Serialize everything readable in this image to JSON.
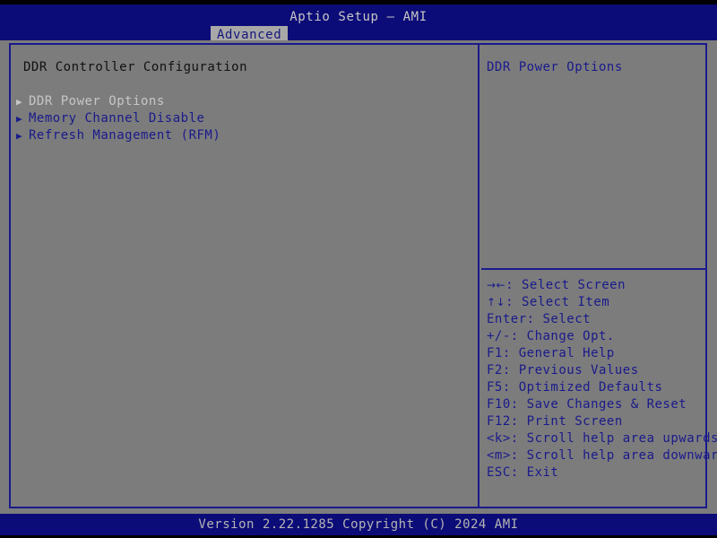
{
  "header": {
    "title": "Aptio Setup – AMI",
    "tabs": [
      {
        "label": "Advanced",
        "active": true
      }
    ]
  },
  "left_pane": {
    "title": "DDR Controller Configuration",
    "menu_items": [
      {
        "arrow": "▶",
        "label": "DDR Power Options",
        "selected": true
      },
      {
        "arrow": "▶",
        "label": "Memory Channel Disable",
        "selected": false
      },
      {
        "arrow": "▶",
        "label": "Refresh Management (RFM)",
        "selected": false
      }
    ]
  },
  "right_pane": {
    "help_text": "DDR Power Options",
    "key_legend": [
      {
        "glyph": "→←",
        "text": ": Select Screen"
      },
      {
        "glyph": "↑↓",
        "text": ": Select Item"
      },
      {
        "glyph": "",
        "text": "Enter: Select"
      },
      {
        "glyph": "",
        "text": "+/-: Change Opt."
      },
      {
        "glyph": "",
        "text": "F1: General Help"
      },
      {
        "glyph": "",
        "text": "F2: Previous Values"
      },
      {
        "glyph": "",
        "text": "F5: Optimized Defaults"
      },
      {
        "glyph": "",
        "text": "F10: Save Changes & Reset"
      },
      {
        "glyph": "",
        "text": "F12: Print Screen"
      },
      {
        "glyph": "",
        "text": "<k>: Scroll help area upwards"
      },
      {
        "glyph": "",
        "text": "<m>: Scroll help area downwards"
      },
      {
        "glyph": "",
        "text": "ESC: Exit"
      }
    ]
  },
  "footer": {
    "version_text": "Version 2.22.1285 Copyright (C) 2024 AMI"
  },
  "colors": {
    "background_gray": "#7c7c7c",
    "header_navy": "#0c0c78",
    "border_blue": "#1a1a8c",
    "text_blue": "#1a1a8c",
    "text_light": "#c6c6c6",
    "text_dark": "#111111",
    "tab_active_bg": "#a8a8a8"
  }
}
